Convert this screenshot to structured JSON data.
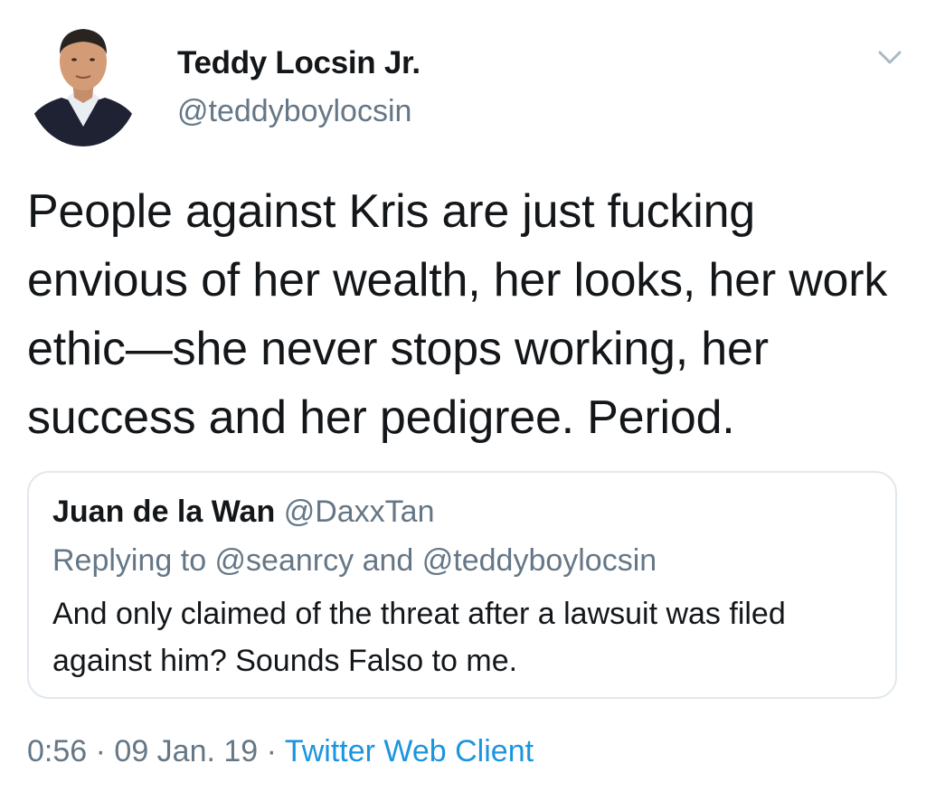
{
  "author": {
    "name": "Teddy Locsin Jr.",
    "handle": "@teddyboylocsin"
  },
  "tweet": {
    "text": "People against Kris are just fucking envious of her wealth, her looks, her work ethic—she never stops working, her success and her pedigree. Period."
  },
  "quoted_tweet": {
    "name": "Juan de la Wan",
    "handle": "@DaxxTan",
    "replying_prefix": "Replying to ",
    "reply_user_1": "@seanrcy",
    "reply_and": " and ",
    "reply_user_2": "@teddyboylocsin",
    "text": "And only claimed of the threat after a lawsuit was filed against him? Sounds Falso to me."
  },
  "meta": {
    "time": "0:56",
    "sep1": " · ",
    "date": "09 Jan. 19",
    "sep2": " · ",
    "source": "Twitter Web Client"
  },
  "icons": {
    "caret": "chevron-down-icon",
    "avatar": "profile-photo"
  },
  "colors": {
    "text": "#14171a",
    "secondary": "#657786",
    "link": "#1b95e0",
    "border": "#e1e8ed"
  }
}
